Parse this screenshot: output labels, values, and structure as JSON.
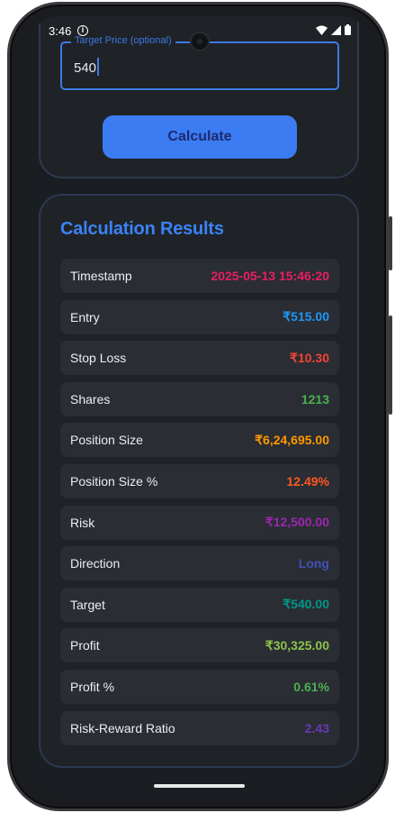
{
  "status": {
    "time": "3:46"
  },
  "form": {
    "target_label": "Target Price (optional)",
    "target_value": "540",
    "calculate_label": "Calculate"
  },
  "results": {
    "title": "Calculation Results",
    "rows": [
      {
        "label": "Timestamp",
        "value": "2025-05-13 15:46:20",
        "color": "#e91e63"
      },
      {
        "label": "Entry",
        "value": "₹515.00",
        "color": "#2196f3"
      },
      {
        "label": "Stop Loss",
        "value": "₹10.30",
        "color": "#f44336"
      },
      {
        "label": "Shares",
        "value": "1213",
        "color": "#4caf50"
      },
      {
        "label": "Position Size",
        "value": "₹6,24,695.00",
        "color": "#ff9800"
      },
      {
        "label": "Position Size %",
        "value": "12.49%",
        "color": "#ff5722"
      },
      {
        "label": "Risk",
        "value": "₹12,500.00",
        "color": "#9c27b0"
      },
      {
        "label": "Direction",
        "value": "Long",
        "color": "#3f51b5"
      },
      {
        "label": "Target",
        "value": "₹540.00",
        "color": "#009688"
      },
      {
        "label": "Profit",
        "value": "₹30,325.00",
        "color": "#8bc34a"
      },
      {
        "label": "Profit %",
        "value": "0.61%",
        "color": "#4caf50"
      },
      {
        "label": "Risk-Reward Ratio",
        "value": "2.43",
        "color": "#673ab7"
      }
    ]
  }
}
